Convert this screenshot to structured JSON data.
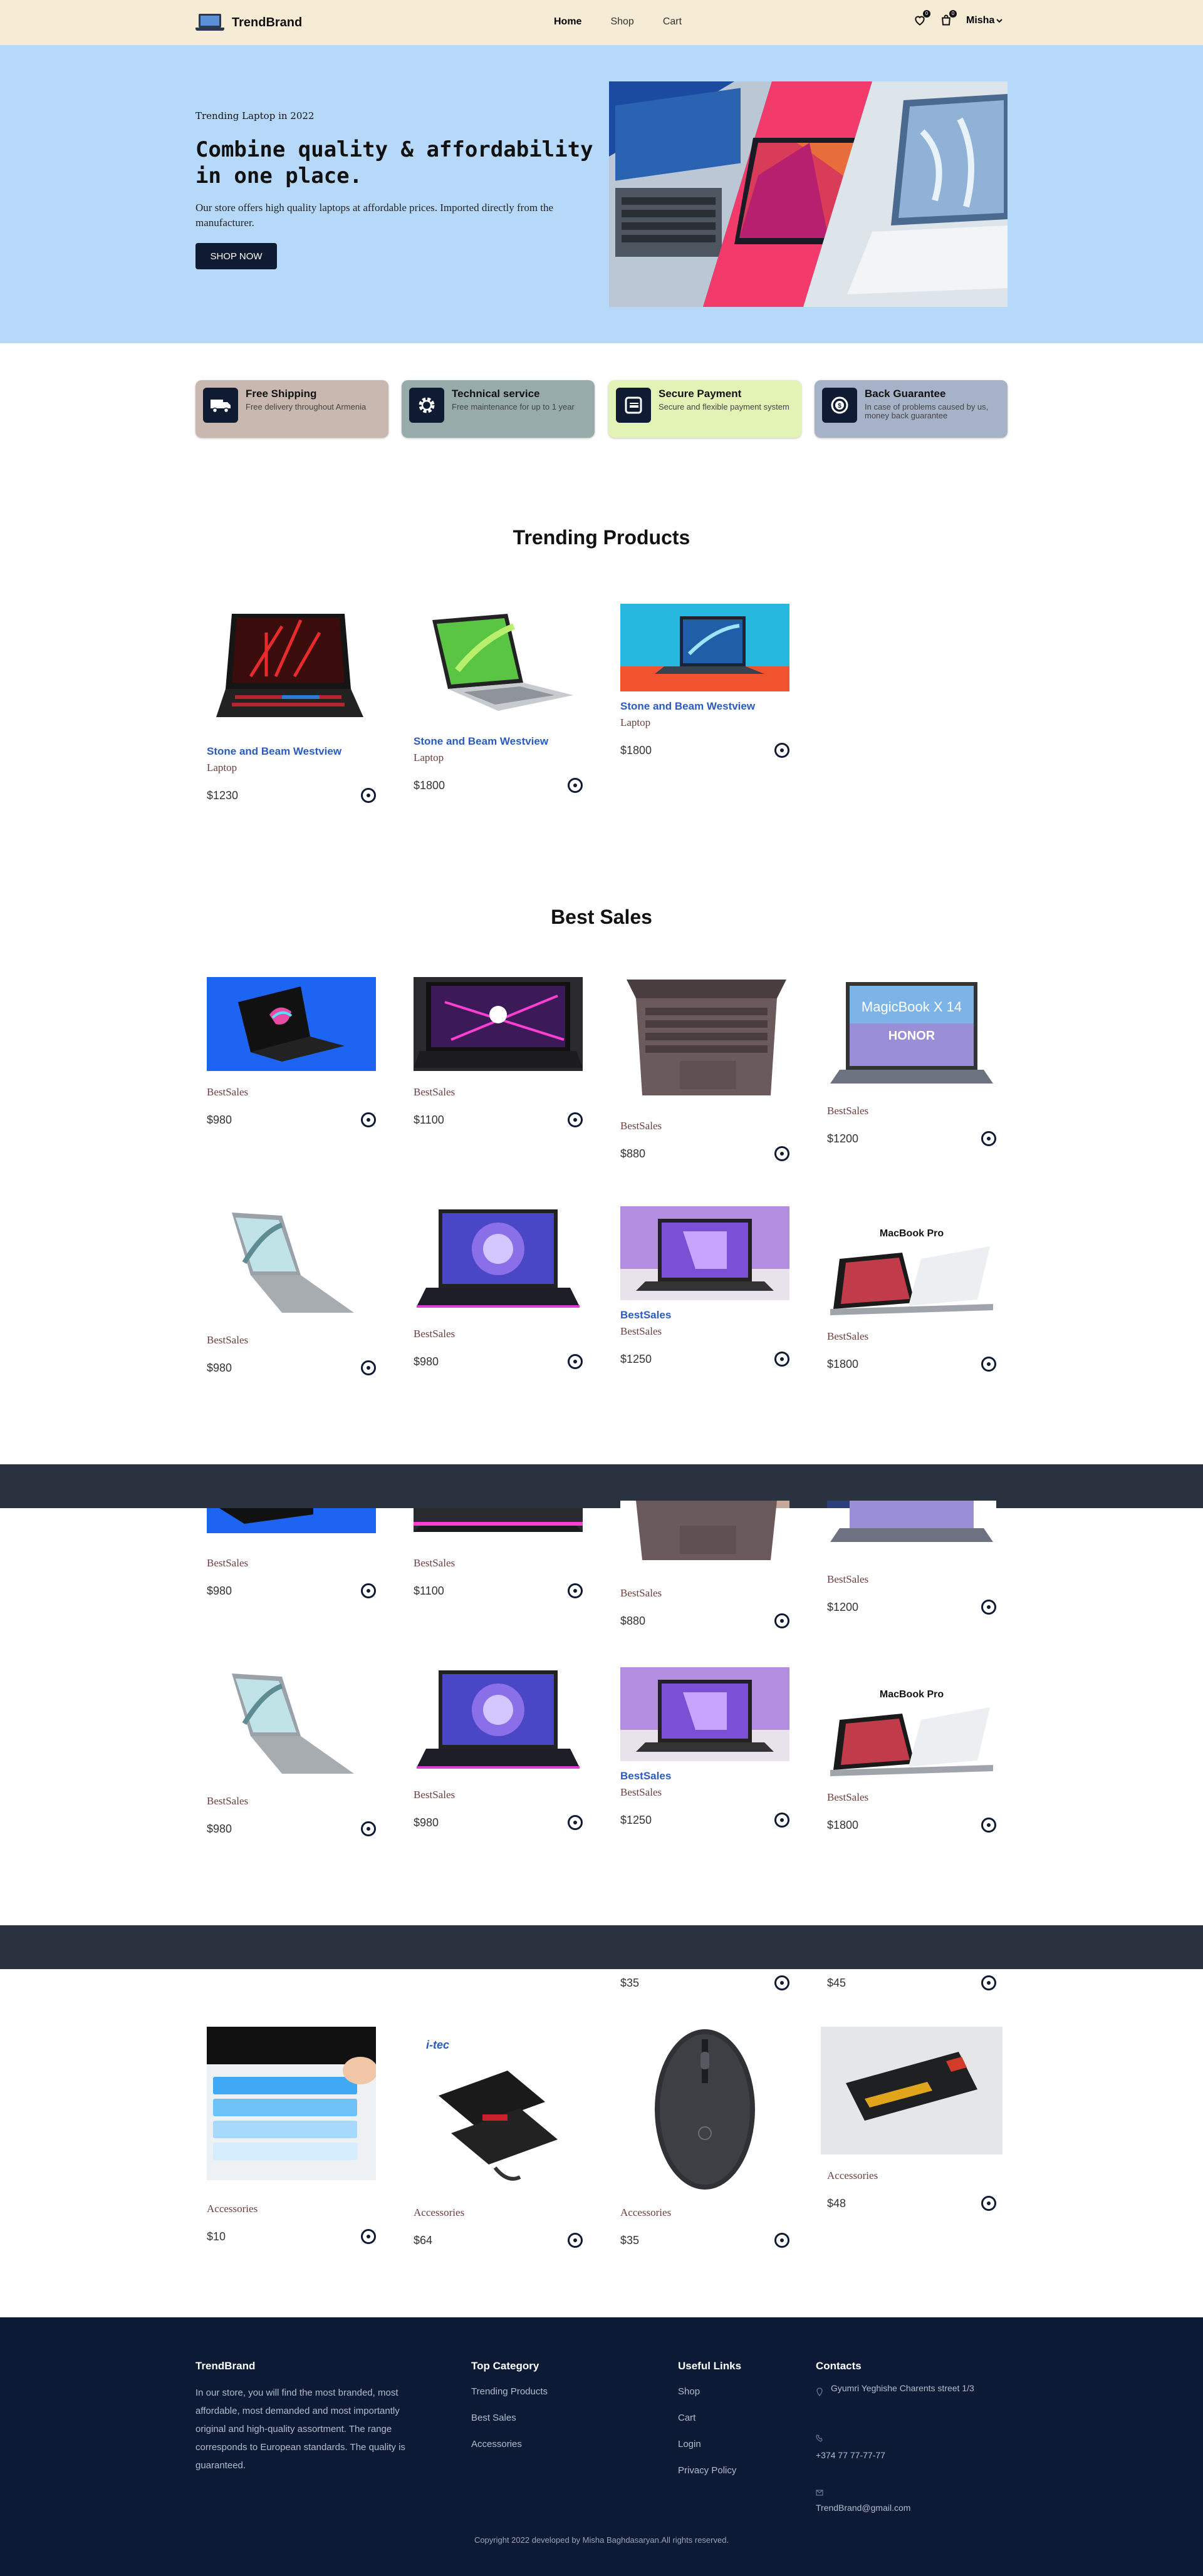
{
  "header": {
    "brand": "TrendBrand",
    "nav": [
      "Home",
      "Shop",
      "Cart"
    ],
    "wishlist_count": "0",
    "cart_count": "0",
    "user": "Misha"
  },
  "hero": {
    "eyebrow": "Trending Laptop in 2022",
    "title": "Combine quality & affordability in one place.",
    "text": "Our store offers high quality laptops at affordable prices. Imported directly from the manufacturer.",
    "button": "SHOP NOW"
  },
  "features": [
    {
      "title": "Free Shipping",
      "desc": "Free delivery throughout Armenia",
      "color": "#c8b8b0",
      "icon": "truck-icon"
    },
    {
      "title": "Technical service",
      "desc": "Free maintenance for up to 1 year",
      "color": "#97abab",
      "icon": "gear-icon"
    },
    {
      "title": "Secure Payment",
      "desc": "Secure and flexible payment system",
      "color": "#e3f2b5",
      "icon": "card-icon"
    },
    {
      "title": "Back Guarantee",
      "desc": "In case of problems caused by us, money back guarantee",
      "color": "#a6b2c8",
      "icon": "money-back-icon"
    }
  ],
  "trending": {
    "title": "Trending Products",
    "items": [
      {
        "name": "Stone and Beam Westview",
        "category": "Laptop",
        "price": "$1230"
      },
      {
        "name": "Stone and Beam Westview",
        "category": "Laptop",
        "price": "$1800"
      },
      {
        "name": "Stone and Beam Westview",
        "category": "Laptop",
        "price": "$1800"
      }
    ]
  },
  "best": {
    "title": "Best Sales",
    "row1": [
      {
        "name": "",
        "category": "BestSales",
        "price": "$980"
      },
      {
        "name": "",
        "category": "BestSales",
        "price": "$1100"
      },
      {
        "name": "",
        "category": "BestSales",
        "price": "$880"
      },
      {
        "name": "",
        "category": "BestSales",
        "price": "$1200"
      }
    ],
    "row2": [
      {
        "name": "",
        "category": "BestSales",
        "price": "$980"
      },
      {
        "name": "",
        "category": "BestSales",
        "price": "$980"
      },
      {
        "name": "BestSales",
        "category": "BestSales",
        "price": "$1250"
      },
      {
        "name": "",
        "category": "BestSales",
        "price": "$1800"
      }
    ]
  },
  "accessories": {
    "prev_prices": [
      "$35",
      "$45"
    ],
    "items": [
      {
        "category": "Accessories",
        "price": "$10"
      },
      {
        "category": "Accessories",
        "price": "$64"
      },
      {
        "category": "Accessories",
        "price": "$35"
      },
      {
        "category": "Accessories",
        "price": "$48"
      }
    ],
    "brand_label": "i-tec"
  },
  "macbook_label": "MacBook Pro",
  "honor_label": "MagicBook X 14",
  "honor_brand": "HONOR",
  "footer": {
    "brand": "TrendBrand",
    "about": "In our store, you will find the most branded, most affordable, most demanded and most importantly original and high-quality assortment. The range corresponds to European standards. The quality is guaranteed.",
    "top_category_title": "Top Category",
    "top_category": [
      "Trending Products",
      "Best Sales",
      "Accessories"
    ],
    "useful_title": "Useful Links",
    "useful": [
      "Shop",
      "Cart",
      "Login",
      "Privacy Policy"
    ],
    "contacts_title": "Contacts",
    "address": "Gyumri Yeghishe Charents street 1/3",
    "phone": "+374 77 77-77-77",
    "email": "TrendBrand@gmail.com",
    "copyright": "Copyright 2022 developed by Misha Baghdasaryan.All rights reserved."
  }
}
